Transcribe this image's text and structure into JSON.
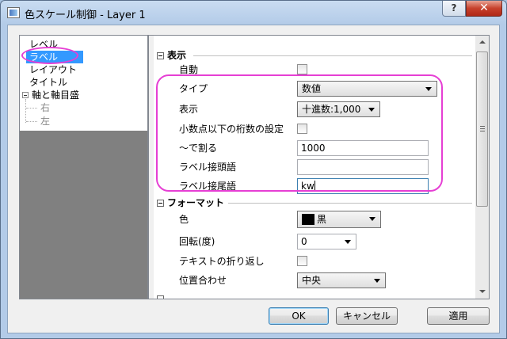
{
  "window": {
    "title": "色スケール制御 - Layer 1",
    "help_label": "?",
    "close_label": "✕"
  },
  "tree": {
    "items": [
      {
        "label": "レベル"
      },
      {
        "label": "ラベル",
        "selected": true
      },
      {
        "label": "レイアウト"
      },
      {
        "label": "タイトル"
      },
      {
        "label": "軸と軸目盛"
      },
      {
        "label": "右"
      },
      {
        "label": "左"
      }
    ]
  },
  "sections": {
    "display": {
      "header": "表示",
      "auto_label": "自動",
      "type_label": "タイプ",
      "type_value": "数値",
      "show_label": "表示",
      "show_value": "十進数:1,000",
      "decimal_label": "小数点以下の桁数の設定",
      "divide_label": "～で割る",
      "divide_value": "1000",
      "prefix_label": "ラベル接頭語",
      "prefix_value": "",
      "suffix_label": "ラベル接尾語",
      "suffix_value": "kw"
    },
    "format": {
      "header": "フォーマット",
      "color_label": "色",
      "color_value": "黒",
      "rotate_label": "回転(度)",
      "rotate_value": "0",
      "wrap_label": "テキストの折り返し",
      "align_label": "位置合わせ",
      "align_value": "中央"
    }
  },
  "buttons": {
    "ok": "OK",
    "cancel": "キャンセル",
    "apply": "適用"
  },
  "colors": {
    "selection": "#3399ff",
    "annotation": "#e63fd4"
  }
}
